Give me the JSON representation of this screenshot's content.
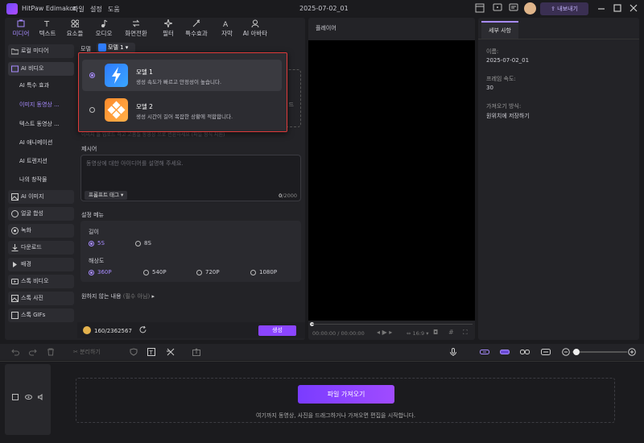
{
  "app": {
    "name": "HitPaw Edimakor",
    "menus": [
      "파일",
      "설정",
      "도움"
    ],
    "project_name": "2025-07-02_01",
    "export_label": "내보내기"
  },
  "toolbar": [
    {
      "label": "미디어",
      "icon": "media-icon",
      "active": true
    },
    {
      "label": "텍스트",
      "icon": "text-icon"
    },
    {
      "label": "요소들",
      "icon": "elements-icon"
    },
    {
      "label": "오디오",
      "icon": "audio-icon"
    },
    {
      "label": "화면전환",
      "icon": "transition-icon"
    },
    {
      "label": "필터",
      "icon": "filter-icon"
    },
    {
      "label": "특수효과",
      "icon": "effects-icon"
    },
    {
      "label": "자막",
      "icon": "subtitle-icon"
    },
    {
      "label": "AI 아바타",
      "icon": "avatar-icon"
    }
  ],
  "sidebar": {
    "local_media": "로컬 미디어",
    "ai_video": "AI 비디오",
    "sub_items": [
      "AI 특수 효과",
      "이미지 동영상 ...",
      "텍스트 동영상 ...",
      "AI 애니메이션",
      "AI 트렌지션",
      "나의 창작물"
    ],
    "items": [
      "AI 이미지",
      "얼굴 합성",
      "녹화",
      "다운로드",
      "배경",
      "스톡 비디오",
      "스톡 사진",
      "스톡 GIFs"
    ]
  },
  "main": {
    "model_label": "모델",
    "model_selected": "모델 1",
    "model_options": [
      {
        "title": "모델 1",
        "desc": "생성 속도가 빠르고 안정성이 높습니다.",
        "selected": true
      },
      {
        "title": "모델 2",
        "desc": "생성 시간이 길어 복잡한 상황에 적합합니다.",
        "selected": false
      }
    ],
    "upload_hint_partial": "드",
    "faded_hint": "이미지 들 업로드 하고 고품질 동영상 으로 변환하세요 (파일 형식 지원)",
    "prompt_label": "제시어",
    "prompt_placeholder": "동영상에 대한 아이디어를 설명해 주세요.",
    "prompt_tag": "프롬프트 태그",
    "char_count": "0",
    "char_max": "/2000",
    "settings_title": "설정 메뉴",
    "length_label": "길이",
    "length_options": [
      "5S",
      "8S"
    ],
    "resolution_label": "해상도",
    "resolution_options": [
      "360P",
      "540P",
      "720P",
      "1080P"
    ],
    "negative_label": "원하지 않는 내용",
    "negative_optional": "(필수 아님)",
    "credits": "160/2362567",
    "generate_label": "생성"
  },
  "player": {
    "title": "플레이어",
    "time": "00:00:00 / 00:00:00",
    "ratio": "16:9"
  },
  "details": {
    "tab": "세부 사항",
    "name_label": "이름:",
    "name_value": "2025-07-02_01",
    "fps_label": "프레임 속도:",
    "fps_value": "30",
    "import_label": "가져오기 방식:",
    "import_value": "원위치에 저장하기"
  },
  "timeline": {
    "toolbar": [
      "undo",
      "redo",
      "delete",
      "분리하기"
    ],
    "import_button": "파일 가져오기",
    "drop_hint": "여기까지 동영상, 사진을 드래그하거나 가져오면 편집을 시작합니다."
  },
  "colors": {
    "accent": "#a78bff",
    "highlight_border": "#e03a3a",
    "generate": "#8b45ff"
  }
}
